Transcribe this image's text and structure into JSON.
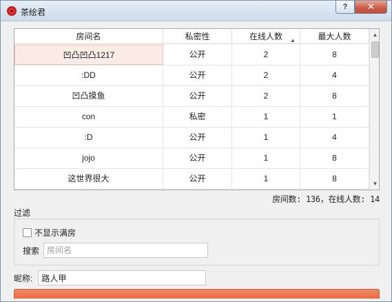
{
  "window": {
    "title": "茶绘君",
    "help_label": "?",
    "close_label": "✕",
    "icon": "red-flower-app-icon"
  },
  "table": {
    "columns": [
      "房间名",
      "私密性",
      "在线人数",
      "最大人数"
    ],
    "sort_indicator": "▲",
    "rows": [
      {
        "name": "凹凸凹凸1217",
        "privacy": "公开",
        "online": "2",
        "max": "8"
      },
      {
        "name": ":DD",
        "privacy": "公开",
        "online": "2",
        "max": "4"
      },
      {
        "name": "凹凸摸鱼",
        "privacy": "公开",
        "online": "2",
        "max": "8"
      },
      {
        "name": "con",
        "privacy": "私密",
        "online": "1",
        "max": "1"
      },
      {
        "name": ":D",
        "privacy": "公开",
        "online": "1",
        "max": "4"
      },
      {
        "name": "jojo",
        "privacy": "公开",
        "online": "1",
        "max": "8"
      },
      {
        "name": "这世界很大",
        "privacy": "公开",
        "online": "1",
        "max": "8"
      }
    ],
    "scroll_up": "▲",
    "scroll_down": "▼"
  },
  "stats": "房间数: 136，在线人数: 14",
  "filter": {
    "label": "过滤",
    "hide_full_label": "不显示满房",
    "search_label": "搜索",
    "search_placeholder": "房间名",
    "search_value": ""
  },
  "nickname": {
    "label": "昵称:",
    "value": "路人甲"
  },
  "colors": {
    "accent": "#e96a40",
    "selected_row": "#fbebe6"
  }
}
